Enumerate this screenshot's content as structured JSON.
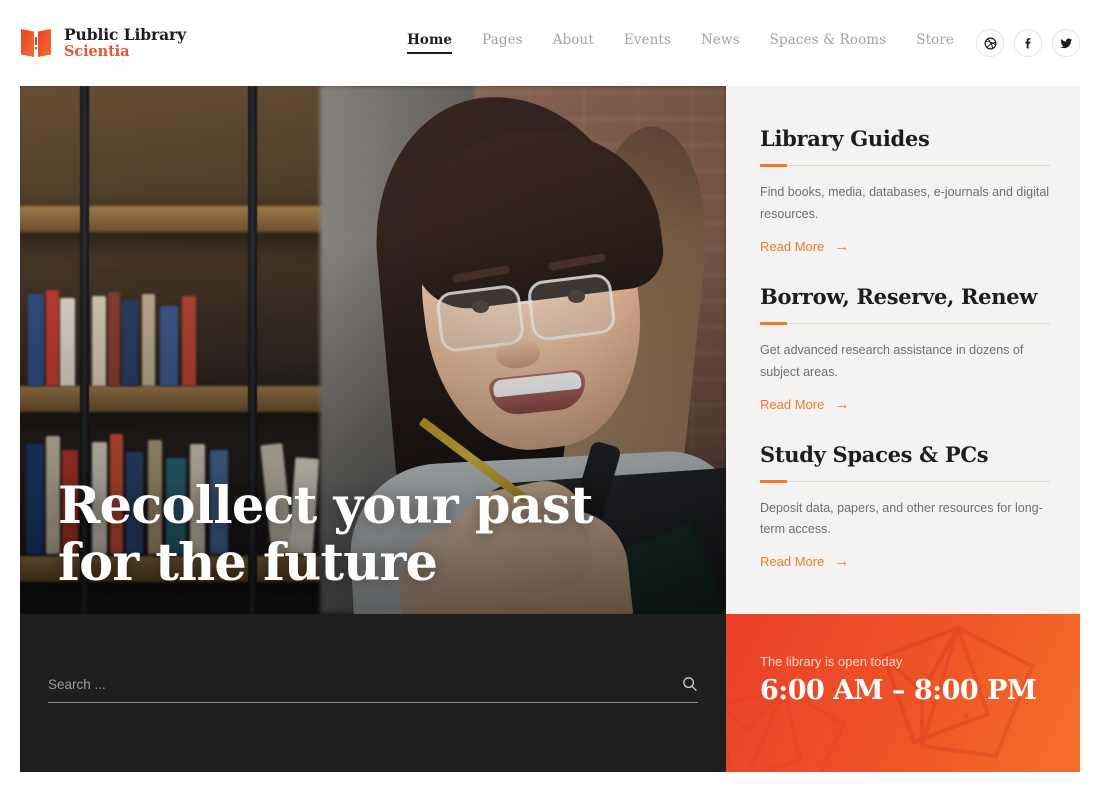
{
  "brand": {
    "icon": "open-book-icon",
    "line1": "Public Library",
    "line2": "Scientia"
  },
  "nav": {
    "items": [
      {
        "label": "Home",
        "active": true
      },
      {
        "label": "Pages",
        "active": false
      },
      {
        "label": "About",
        "active": false
      },
      {
        "label": "Events",
        "active": false
      },
      {
        "label": "News",
        "active": false
      },
      {
        "label": "Spaces & Rooms",
        "active": false
      },
      {
        "label": "Store",
        "active": false
      }
    ]
  },
  "socials": [
    {
      "name": "dribbble-icon"
    },
    {
      "name": "facebook-icon"
    },
    {
      "name": "twitter-icon"
    }
  ],
  "hero": {
    "title_line1": "Recollect your past",
    "title_line2": "for the future",
    "image_alt": "smiling woman with glasses holding a pencil in a library"
  },
  "sidebar": {
    "guides": [
      {
        "title": "Library Guides",
        "description": "Find books, media, databases, e-journals and digital resources.",
        "link_label": "Read More",
        "link_arrow": "→"
      },
      {
        "title": "Borrow, Reserve, Renew",
        "description": "Get advanced research assistance in dozens of subject areas.",
        "link_label": "Read More",
        "link_arrow": "→"
      },
      {
        "title": "Study Spaces & PCs",
        "description": "Deposit data, papers, and other resources for long-term access.",
        "link_label": "Read More",
        "link_arrow": "→"
      }
    ]
  },
  "search": {
    "placeholder": "Search ...",
    "value": "",
    "icon": "search-icon"
  },
  "hours": {
    "label": "The library is open today",
    "value": "6:00 AM – 8:00 PM"
  },
  "colors": {
    "accent_orange": "#ed7a2e",
    "brand_red": "#e8412b",
    "panel_dark": "#1e1e1e",
    "sidebar_bg": "#f4f3f1",
    "text_dark": "#1d1d1d",
    "text_muted": "#a3a3a3"
  }
}
